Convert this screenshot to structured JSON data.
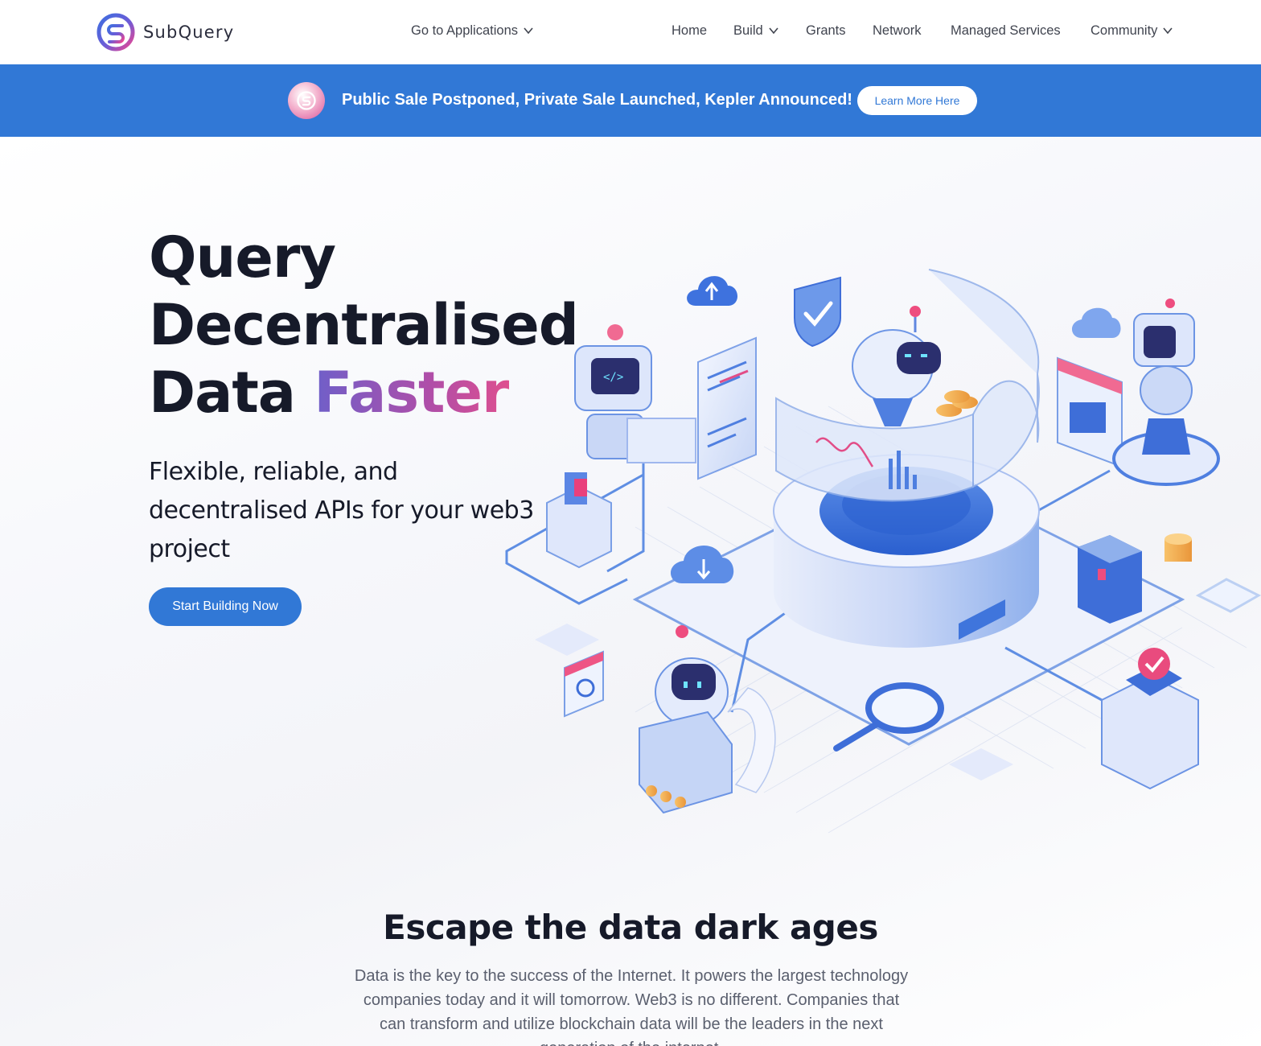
{
  "nav": {
    "brand": "SubQuery",
    "go_to_apps": "Go to Applications",
    "links": {
      "home": "Home",
      "build": "Build",
      "grants": "Grants",
      "network": "Network",
      "managed": "Managed Services",
      "community": "Community"
    },
    "icons": [
      "subquery-logo",
      "chevron-down-icon"
    ]
  },
  "banner": {
    "text": "Public Sale Postponed, Private Sale Launched, Kepler Announced!",
    "button": "Learn More Here"
  },
  "hero": {
    "title_line1": "Query",
    "title_line2": "Decentralised",
    "title_line3_a": "Data ",
    "title_line3_b": "Faster",
    "subtitle": "Flexible, reliable, and decentralised APIs for your web3 project",
    "cta": "Start Building Now"
  },
  "section": {
    "title": "Escape the data dark ages",
    "body": "Data is the key to the success of the Internet. It powers the largest technology companies today and it will tomorrow. Web3 is no different. Companies that can transform and utilize blockchain data will be the leaders in the next generation of the internet."
  },
  "colors": {
    "primary": "#3178d6",
    "gradient_start": "#6f5fc9",
    "gradient_end": "#de4f8f",
    "text_dark": "#161a29"
  }
}
